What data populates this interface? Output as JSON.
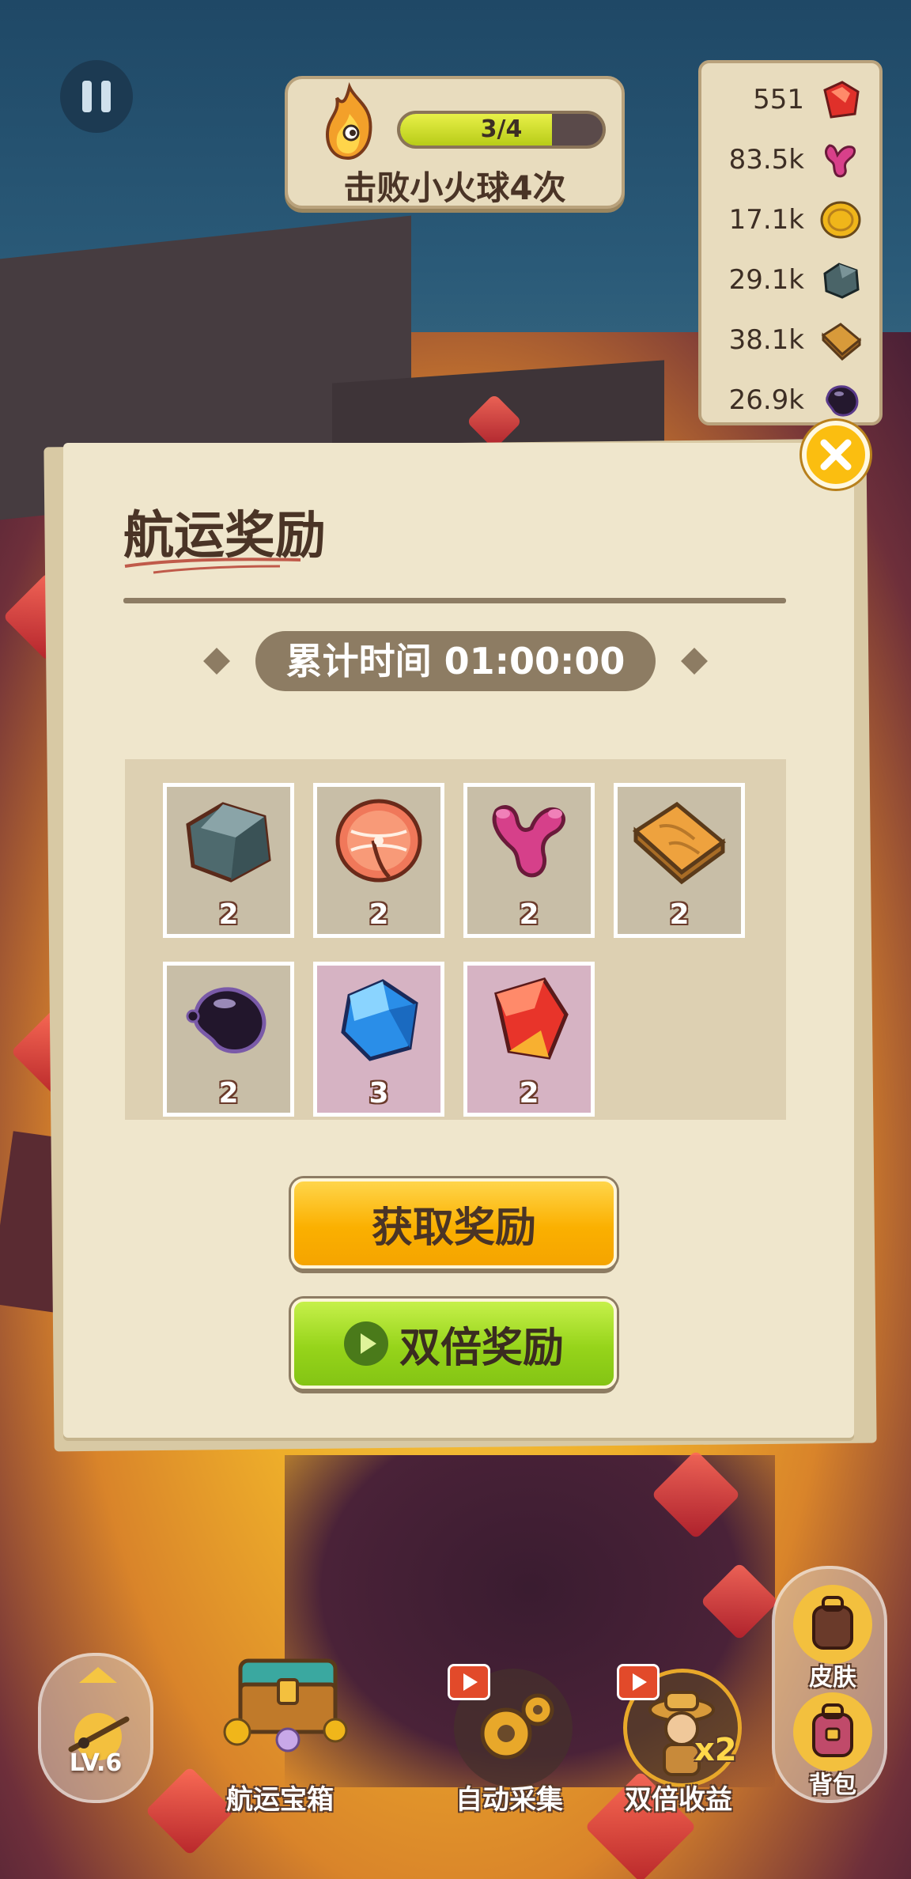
{
  "quest": {
    "progress_text": "3/4",
    "progress_fraction": 0.75,
    "label": "击败小火球4次",
    "icon": "fireball-icon"
  },
  "resources": [
    {
      "value": "551",
      "icon": "red-gem-icon"
    },
    {
      "value": "83.5k",
      "icon": "coral-icon"
    },
    {
      "value": "17.1k",
      "icon": "gold-coin-icon"
    },
    {
      "value": "29.1k",
      "icon": "stone-icon"
    },
    {
      "value": "38.1k",
      "icon": "wood-plank-icon"
    },
    {
      "value": "26.9k",
      "icon": "oil-icon"
    }
  ],
  "dialog": {
    "title": "航运奖励",
    "timer_label": "累计时间 01:00:00",
    "rewards": [
      {
        "icon": "stone-icon",
        "count": "2",
        "rarity": "common"
      },
      {
        "icon": "salmon-steak-icon",
        "count": "2",
        "rarity": "common"
      },
      {
        "icon": "coral-icon",
        "count": "2",
        "rarity": "common"
      },
      {
        "icon": "wood-plank-icon",
        "count": "2",
        "rarity": "common"
      },
      {
        "icon": "oil-icon",
        "count": "2",
        "rarity": "common"
      },
      {
        "icon": "blue-crystal-icon",
        "count": "3",
        "rarity": "rare"
      },
      {
        "icon": "red-crystal-icon",
        "count": "2",
        "rarity": "rare"
      }
    ],
    "claim_label": "获取奖励",
    "double_label": "双倍奖励"
  },
  "bottom_bar": {
    "level_label": "LV.6",
    "items": [
      {
        "label": "航运宝箱",
        "icon": "treasure-chest-icon"
      },
      {
        "label": "自动采集",
        "icon": "gear-icon"
      },
      {
        "label": "双倍收益",
        "icon": "explorer-icon",
        "badge": "x2"
      }
    ]
  },
  "side_panel": {
    "skin_label": "皮肤",
    "backpack_label": "背包"
  },
  "colors": {
    "dialog_bg": "#efe6cc",
    "claim_button": "#fbb000",
    "double_button": "#96d41a",
    "accent_brown": "#8d7c63"
  }
}
